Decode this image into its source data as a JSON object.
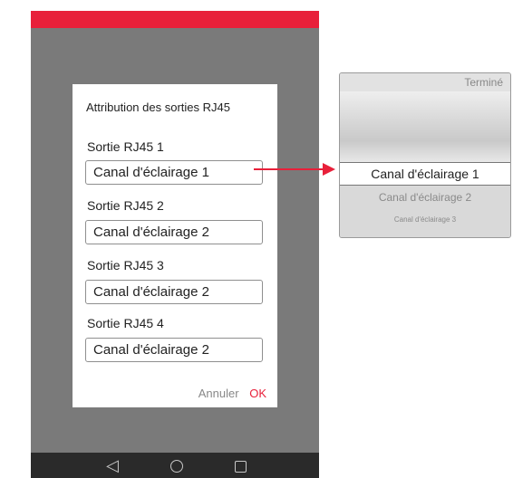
{
  "dialog": {
    "title": "Attribution des sorties RJ45",
    "fields": [
      {
        "label": "Sortie RJ45 1",
        "value": "Canal d'éclairage 1"
      },
      {
        "label": "Sortie RJ45 2",
        "value": "Canal d'éclairage 2"
      },
      {
        "label": "Sortie RJ45 3",
        "value": "Canal d'éclairage 2"
      },
      {
        "label": "Sortie RJ45 4",
        "value": "Canal d'éclairage 2"
      }
    ],
    "cancel_label": "Annuler",
    "ok_label": "OK"
  },
  "picker": {
    "done_label": "Terminé",
    "selected": "Canal d'éclairage 1",
    "option2": "Canal d'éclairage 2",
    "option3": "Canal d'éclairage 3"
  },
  "navbar": {
    "back_icon": "◁",
    "home_icon": "circle",
    "recent_icon": "square"
  },
  "colors": {
    "accent": "#e8203a",
    "overlay": "#7a7a7a",
    "navbar": "#2a2a2a"
  }
}
